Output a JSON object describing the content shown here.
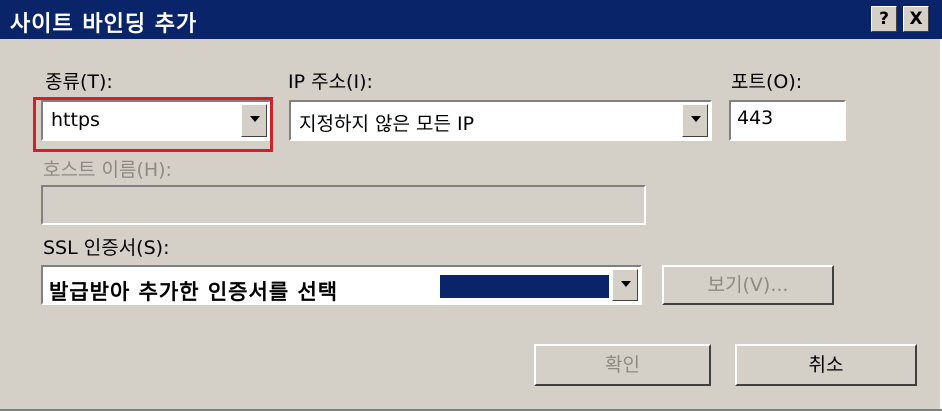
{
  "window": {
    "title": "사이트 바인딩 추가",
    "help_button": "?",
    "close_button": "X"
  },
  "type": {
    "label": "종류(T):",
    "value": "https"
  },
  "ip": {
    "label": "IP 주소(I):",
    "value": "지정하지 않은 모든 IP"
  },
  "port": {
    "label": "포트(O):",
    "value": "443"
  },
  "host": {
    "label": "호스트 이름(H):",
    "value": ""
  },
  "ssl": {
    "label": "SSL 인증서(S):",
    "value": "발급받아 추가한 인증서를 선택",
    "view_button": "보기(V)..."
  },
  "buttons": {
    "ok": "확인",
    "cancel": "취소"
  },
  "colors": {
    "title_bar": "#0a246a",
    "dialog_bg": "#d4d0c8",
    "highlight_box": "#d0202a"
  }
}
